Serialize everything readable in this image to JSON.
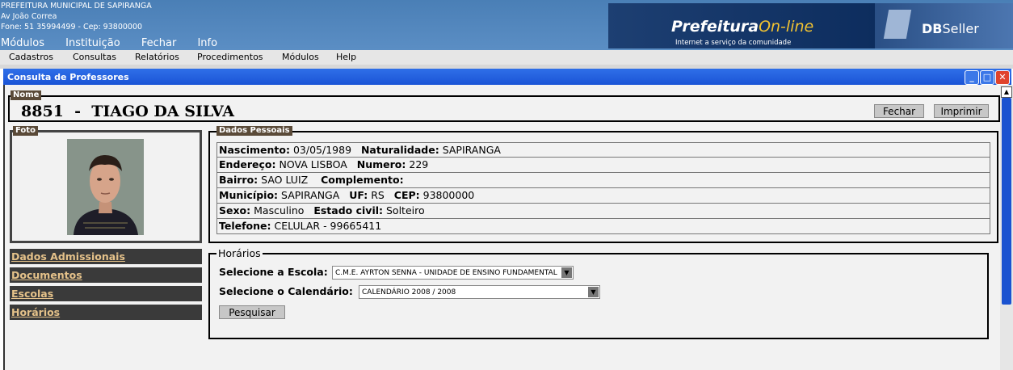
{
  "header": {
    "org": "PREFEITURA MUNICIPAL DE SAPIRANGA",
    "address": "Av João Correa",
    "contact": "Fone: 51 35994499  -  Cep: 93800000",
    "menu": [
      "Módulos",
      "Instituição",
      "Fechar",
      "Info"
    ],
    "brand_main": "Prefeitura",
    "brand_accent": "On-line",
    "brand_sub": "Internet a serviço da comunidade",
    "vendor_bold": "DB",
    "vendor_rest": "Seller"
  },
  "menubar": [
    "Cadastros",
    "Consultas",
    "Relatórios",
    "Procedimentos",
    "Módulos",
    "Help"
  ],
  "window": {
    "title": "Consulta de Professores"
  },
  "nome": {
    "legend": "Nome",
    "code": "8851",
    "sep": "-",
    "name": "TIAGO DA SILVA"
  },
  "buttons": {
    "fechar": "Fechar",
    "imprimir": "Imprimir",
    "pesquisar": "Pesquisar"
  },
  "foto": {
    "legend": "Foto"
  },
  "dados_pessoais": {
    "legend": "Dados Pessoais",
    "nascimento_label": "Nascimento:",
    "nascimento": "03/05/1989",
    "naturalidade_label": "Naturalidade:",
    "naturalidade": "SAPIRANGA",
    "endereco_label": "Endereço:",
    "endereco": "NOVA LISBOA",
    "numero_label": "Numero:",
    "numero": "229",
    "bairro_label": "Bairro:",
    "bairro": "SAO LUIZ",
    "complemento_label": "Complemento:",
    "complemento": "",
    "municipio_label": "Município:",
    "municipio": "SAPIRANGA",
    "uf_label": "UF:",
    "uf": "RS",
    "cep_label": "CEP:",
    "cep": "93800000",
    "sexo_label": "Sexo:",
    "sexo": "Masculino",
    "estado_civil_label": "Estado civil:",
    "estado_civil": "Solteiro",
    "telefone_label": "Telefone:",
    "telefone": "CELULAR - 99665411"
  },
  "sidebar": [
    "Dados Admissionais",
    "Documentos",
    "Escolas",
    "Horários"
  ],
  "horarios": {
    "legend": "Horários",
    "escola_label": "Selecione a Escola:",
    "escola_value": "C.M.E. AYRTON SENNA - UNIDADE DE ENSINO FUNDAMENTAL",
    "calendario_label": "Selecione o Calendário:",
    "calendario_value": "CALENDÁRIO 2008 / 2008"
  },
  "colors": {
    "titlebar": "#1a54d6",
    "legend_bg": "#5a4a38",
    "sidebar_bg": "#3a3a3a",
    "sidebar_text": "#e5c28a"
  }
}
